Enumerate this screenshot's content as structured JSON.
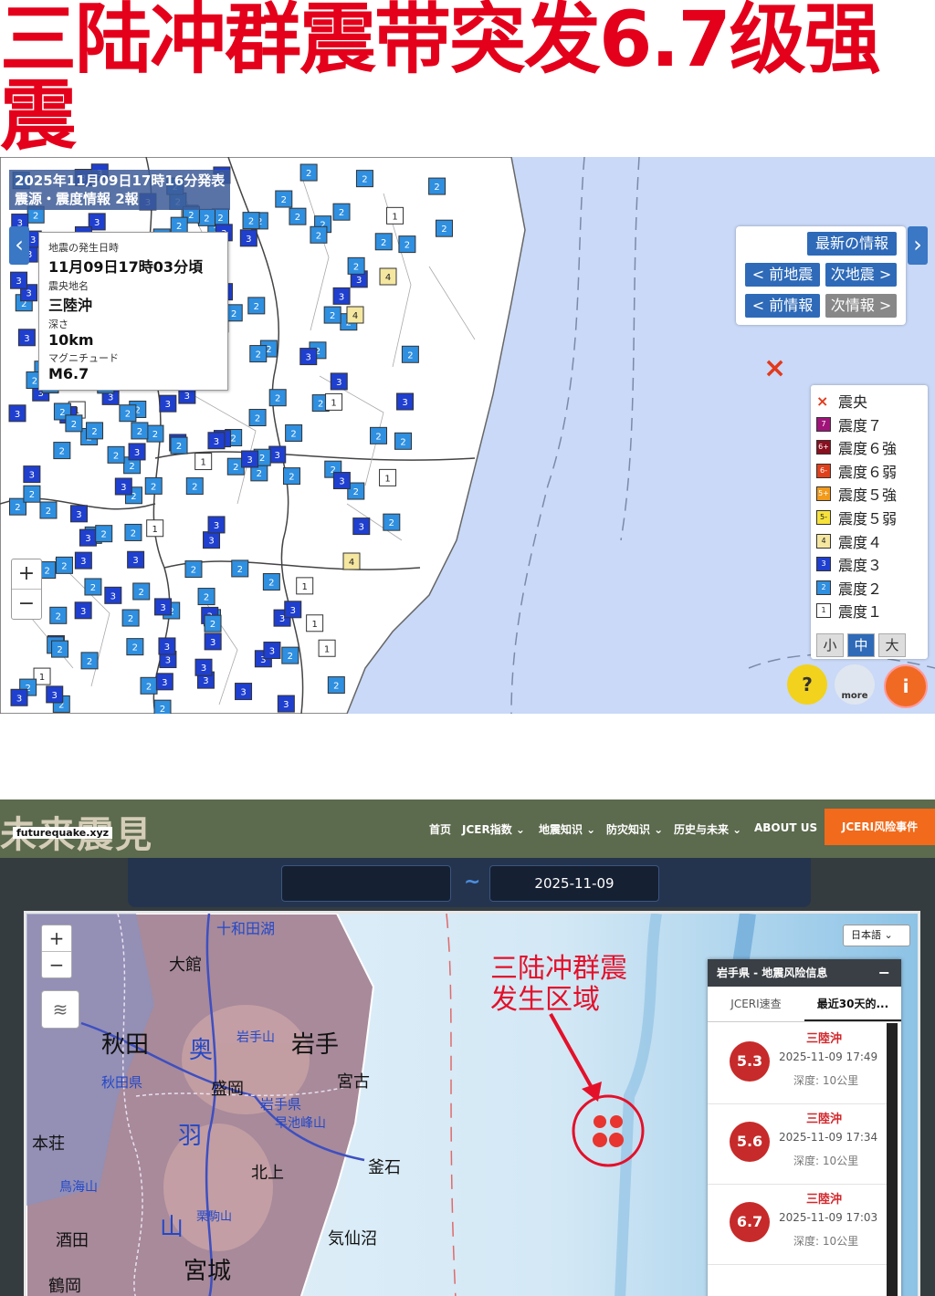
{
  "headline": "三陆冲群震带突发6.7级强震",
  "jma": {
    "publish": "2025年11月09日17時16分発表",
    "report": "震源・震度情報 2報",
    "card": {
      "time_label": "地震の発生日時",
      "time_value": "11月09日17時03分頃",
      "place_label": "震央地名",
      "place_value": "三陸沖",
      "depth_label": "深さ",
      "depth_value": "10km",
      "mag_label": "マグニチュード",
      "mag_value": "M6.7"
    },
    "nav": {
      "latest": "最新の情報",
      "prev_quake": "< 前地震",
      "next_quake": "次地震 >",
      "prev_info": "< 前情報",
      "next_info": "次情報 >"
    },
    "legend": [
      {
        "label": "震央",
        "sw": "",
        "color": "#ffffff"
      },
      {
        "label": "震度７",
        "sw": "7",
        "color": "#a0147a"
      },
      {
        "label": "震度６強",
        "sw": "6+",
        "color": "#8a1020"
      },
      {
        "label": "震度６弱",
        "sw": "6-",
        "color": "#e0401c"
      },
      {
        "label": "震度５強",
        "sw": "5+",
        "color": "#f29a1c"
      },
      {
        "label": "震度５弱",
        "sw": "5-",
        "color": "#f7e23c"
      },
      {
        "label": "震度４",
        "sw": "4",
        "color": "#f5e7a0"
      },
      {
        "label": "震度３",
        "sw": "3",
        "color": "#1f3fcf"
      },
      {
        "label": "震度２",
        "sw": "2",
        "color": "#2f8fe0"
      },
      {
        "label": "震度１",
        "sw": "1",
        "color": "#ffffff"
      }
    ],
    "size_buttons": [
      "小",
      "中",
      "大"
    ],
    "zoom_in": "+",
    "zoom_out": "−",
    "epicenter_symbol": "×",
    "more_label": "more"
  },
  "fq": {
    "logo": "未来震見",
    "domain": "futurequake.xyz",
    "menu": [
      "首页",
      "JCER指数 ⌄",
      "地震知识 ⌄",
      "防灾知识 ⌄",
      "历史与未来 ⌄",
      "ABOUT US"
    ],
    "cta": "JCERI风险事件",
    "date_from": "",
    "date_to": "2025-11-09",
    "tilde": "~",
    "lang": "日本語 ⌄",
    "annotation_line1": "三陆冲群震",
    "annotation_line2": "发生区域",
    "panel_title": "岩手県 - 地震风险信息",
    "panel_close": "−",
    "tabs": [
      "JCERI速查",
      "最近30天的..."
    ],
    "quakes": [
      {
        "mag": "5.3",
        "place": "三陸沖",
        "time": "2025-11-09 17:49",
        "depth": "深度: 10公里"
      },
      {
        "mag": "5.6",
        "place": "三陸沖",
        "time": "2025-11-09 17:34",
        "depth": "深度: 10公里"
      },
      {
        "mag": "6.7",
        "place": "三陸沖",
        "time": "2025-11-09 17:03",
        "depth": "深度: 10公里"
      }
    ],
    "map_labels": [
      "大館",
      "秋田",
      "岩手",
      "秋田県",
      "盛岡",
      "宮古",
      "岩手県",
      "早池峰山",
      "本荘",
      "北上",
      "釜石",
      "鳥海山",
      "酒田",
      "栗駒山",
      "気仙沼",
      "宮城",
      "鶴岡",
      "十和田湖",
      "岩手山",
      "奥",
      "羽",
      "山"
    ],
    "zoom_in": "+",
    "zoom_out": "−"
  }
}
